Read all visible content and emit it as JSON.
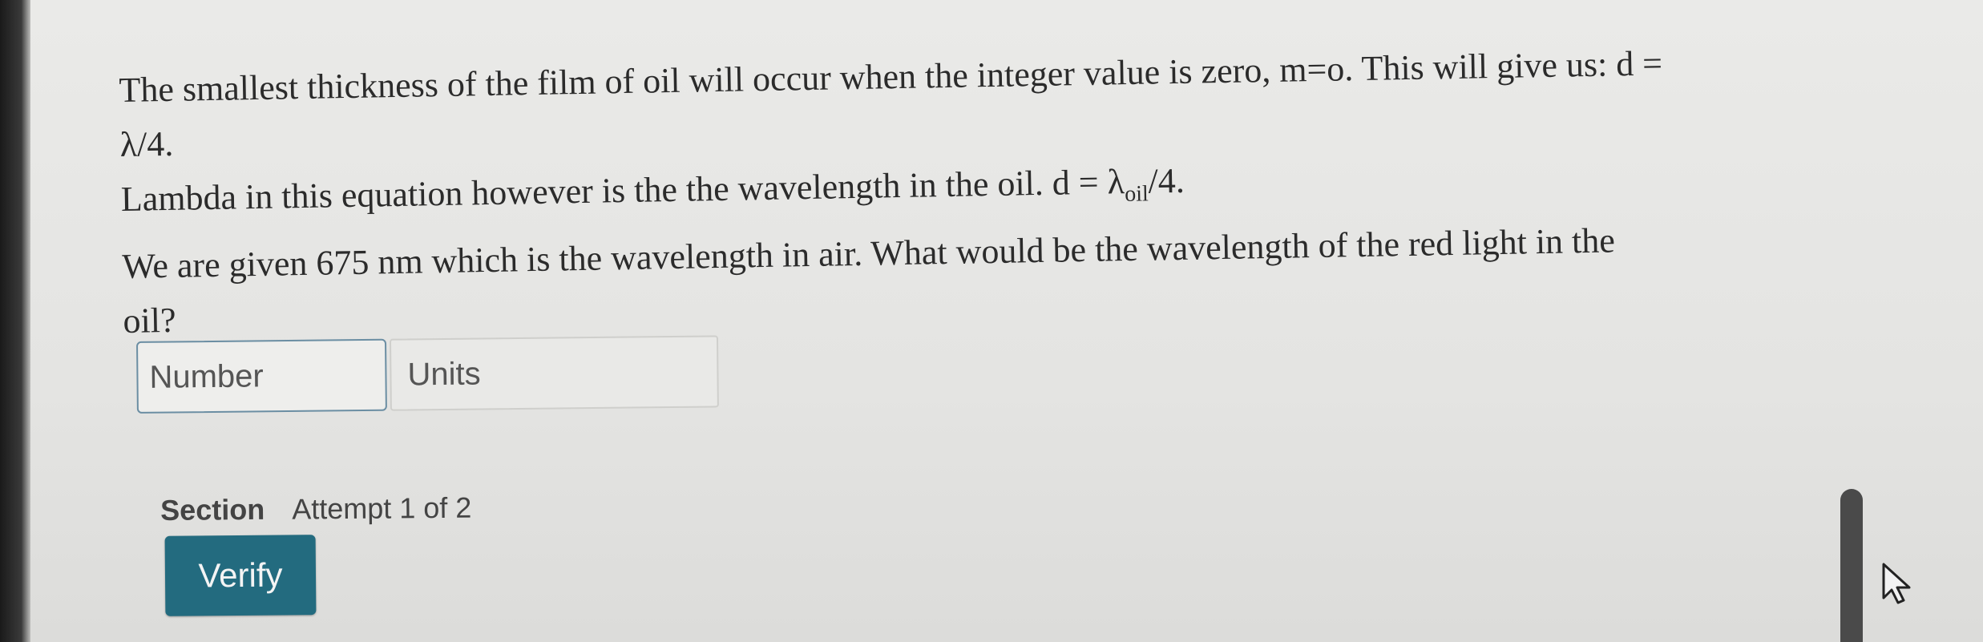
{
  "question": {
    "line1": "The smallest thickness of the film of oil will occur when the integer value is zero, m=o. This will give us: d =",
    "line2": "λ/4.",
    "line3_prefix": "Lambda in this equation however is the the wavelength in the oil. d = λ",
    "line3_subscript": "oil",
    "line3_suffix": "/4.",
    "line4": "We are given 675 nm which is the wavelength in air. What would be the wavelength of the red light in the",
    "line5": "oil?"
  },
  "answer": {
    "number_placeholder": "Number",
    "number_value": "",
    "units_placeholder": "Units"
  },
  "status": {
    "section_label": "Section",
    "attempt_text": "Attempt 1 of 2"
  },
  "actions": {
    "verify_label": "Verify"
  },
  "colors": {
    "accent": "#236b7f",
    "input_border": "#6b8ea3",
    "background": "#e6e6e4"
  },
  "icons": {
    "cursor": "mouse-pointer-icon"
  }
}
